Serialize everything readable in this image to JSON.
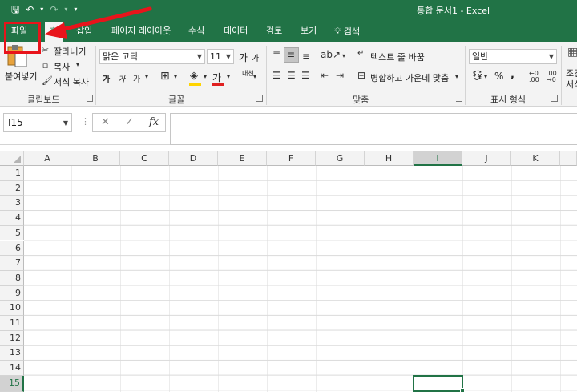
{
  "titlebar": {
    "qat": {
      "save": "🖫",
      "undo": "↶",
      "undo_drop": "▾",
      "redo": "↷",
      "redo_drop": "▾",
      "customize": "▾"
    },
    "title": "통합 문서1  -  Excel"
  },
  "tabs": [
    {
      "label": "파일"
    },
    {
      "label": "홈"
    },
    {
      "label": "삽입"
    },
    {
      "label": "페이지 레이아웃"
    },
    {
      "label": "수식"
    },
    {
      "label": "데이터"
    },
    {
      "label": "검토"
    },
    {
      "label": "보기"
    },
    {
      "label": "검색"
    }
  ],
  "ribbon": {
    "clipboard": {
      "paste": "붙여넣기",
      "cut": "잘라내기",
      "copy": "복사",
      "format_painter": "서식 복사",
      "label": "클립보드"
    },
    "font": {
      "name": "맑은 고딕",
      "size": "11",
      "grow": "가",
      "shrink": "가",
      "bold": "가",
      "italic": "가",
      "underline": "가",
      "font_color": "가",
      "phonetic": "내천",
      "label": "글꼴"
    },
    "alignment": {
      "wrap_text": "텍스트 줄 바꿈",
      "merge_center": "병합하고 가운데 맞춤",
      "label": "맞춤"
    },
    "number": {
      "format": "일반",
      "percent": "%",
      "comma": ",",
      "label": "표시 형식"
    },
    "styles": {
      "cond_label_1": "조건",
      "cond_label_2": "서식"
    }
  },
  "formula_bar": {
    "name_box": "I15",
    "fx": "fx",
    "cancel": "✕",
    "enter": "✓",
    "value": ""
  },
  "grid": {
    "columns": [
      "A",
      "B",
      "C",
      "D",
      "E",
      "F",
      "G",
      "H",
      "I",
      "J",
      "K"
    ],
    "rows": [
      "1",
      "2",
      "3",
      "4",
      "5",
      "6",
      "7",
      "8",
      "9",
      "10",
      "11",
      "12",
      "13",
      "14",
      "15"
    ],
    "selected_column": "I",
    "selected_row": "15"
  },
  "colors": {
    "accent": "#217346",
    "annotation": "#e8141b"
  }
}
